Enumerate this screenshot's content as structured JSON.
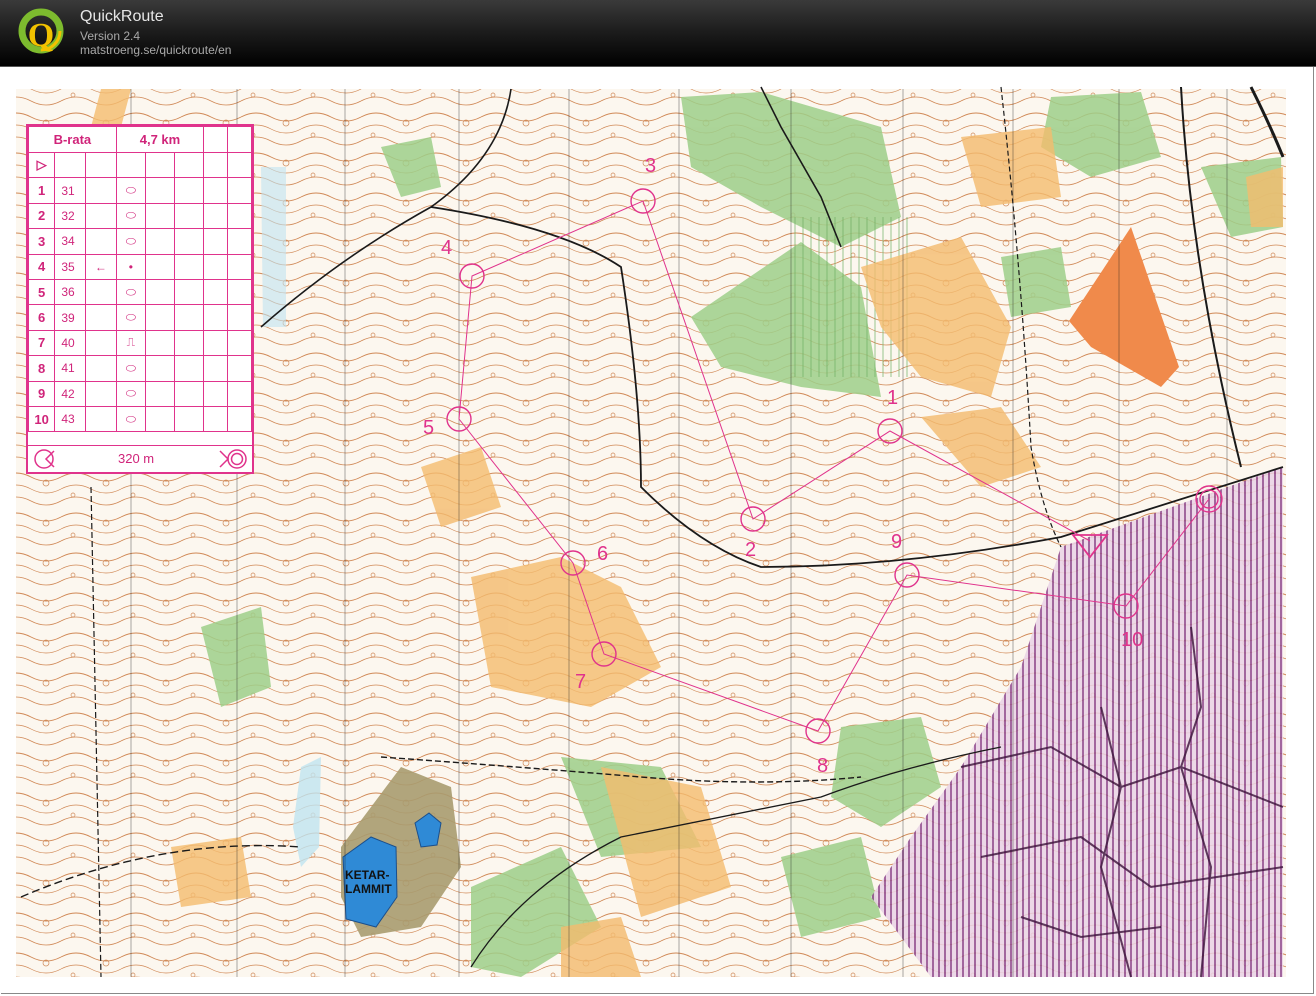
{
  "app": {
    "title": "QuickRoute",
    "version": "Version 2.4",
    "url": "matstroeng.se/quickroute/en"
  },
  "colors": {
    "course": "#e0338c",
    "contour": "#b5652a",
    "vegetation": "#8cc27f",
    "open_land": "#f3b96a",
    "water": "#2f8ad6",
    "restricted": "#7d2b7a"
  },
  "legend": {
    "course_name": "B-rata",
    "length": "4,7 km",
    "start_symbol": "▷",
    "controls": [
      {
        "num": "1",
        "code": "31",
        "symbol": "⬭",
        "extra": ""
      },
      {
        "num": "2",
        "code": "32",
        "symbol": "⬭",
        "extra": ""
      },
      {
        "num": "3",
        "code": "34",
        "symbol": "⬭",
        "extra": ""
      },
      {
        "num": "4",
        "code": "35",
        "symbol": "•",
        "extra": "←"
      },
      {
        "num": "5",
        "code": "36",
        "symbol": "⬭",
        "extra": ""
      },
      {
        "num": "6",
        "code": "39",
        "symbol": "⬭",
        "extra": ""
      },
      {
        "num": "7",
        "code": "40",
        "symbol": "⎍",
        "extra": ""
      },
      {
        "num": "8",
        "code": "41",
        "symbol": "⬭",
        "extra": ""
      },
      {
        "num": "9",
        "code": "42",
        "symbol": "⬭",
        "extra": ""
      },
      {
        "num": "10",
        "code": "43",
        "symbol": "⬭",
        "extra": ""
      }
    ],
    "finish_distance": "320 m"
  },
  "map": {
    "lake_name_line1": "KETAR-",
    "lake_name_line2": "LAMMIT",
    "control_labels": [
      "1",
      "2",
      "3",
      "4",
      "5",
      "6",
      "7",
      "8",
      "9",
      "10"
    ]
  }
}
